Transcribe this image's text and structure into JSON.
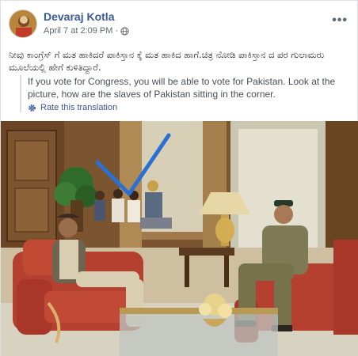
{
  "post": {
    "author": "Devaraj Kotla",
    "timestamp": "April 7 at 2:09 PM",
    "separator": "·",
    "more_label": "•••",
    "body_kannada": "ನೀವು ಕಾಂಗ್ರೆಸ್ ಗೆ ಮತ ಹಾಕಿದರೆ ಪಾಕಿಸ್ತಾನ ಕ್ಕೆ ಮತ ಹಾಕಿದ ಹಾಗೆ.ಚಿತ್ರ ನೋಡಿ ಪಾಕಿಸ್ತಾನ ದ ಪರ ಗುಲಾಮರು ಮೂಲೆಯಲ್ಲಿ ಹೇಗೆ ಕುಳಿತಿದ್ದಾರೆ.",
    "translation": "If you vote for Congress, you will be able to vote for Pakistan. Look at the picture, how are the slaves of Pakistan sitting in the corner.",
    "rate_translation": "Rate this translation"
  },
  "icons": {
    "globe": "globe-icon",
    "gear": "gear-icon",
    "more": "more-options-icon"
  },
  "colors": {
    "author_link": "#385898",
    "meta_text": "#616770",
    "arrow_annotation": "#2a6fd6"
  }
}
